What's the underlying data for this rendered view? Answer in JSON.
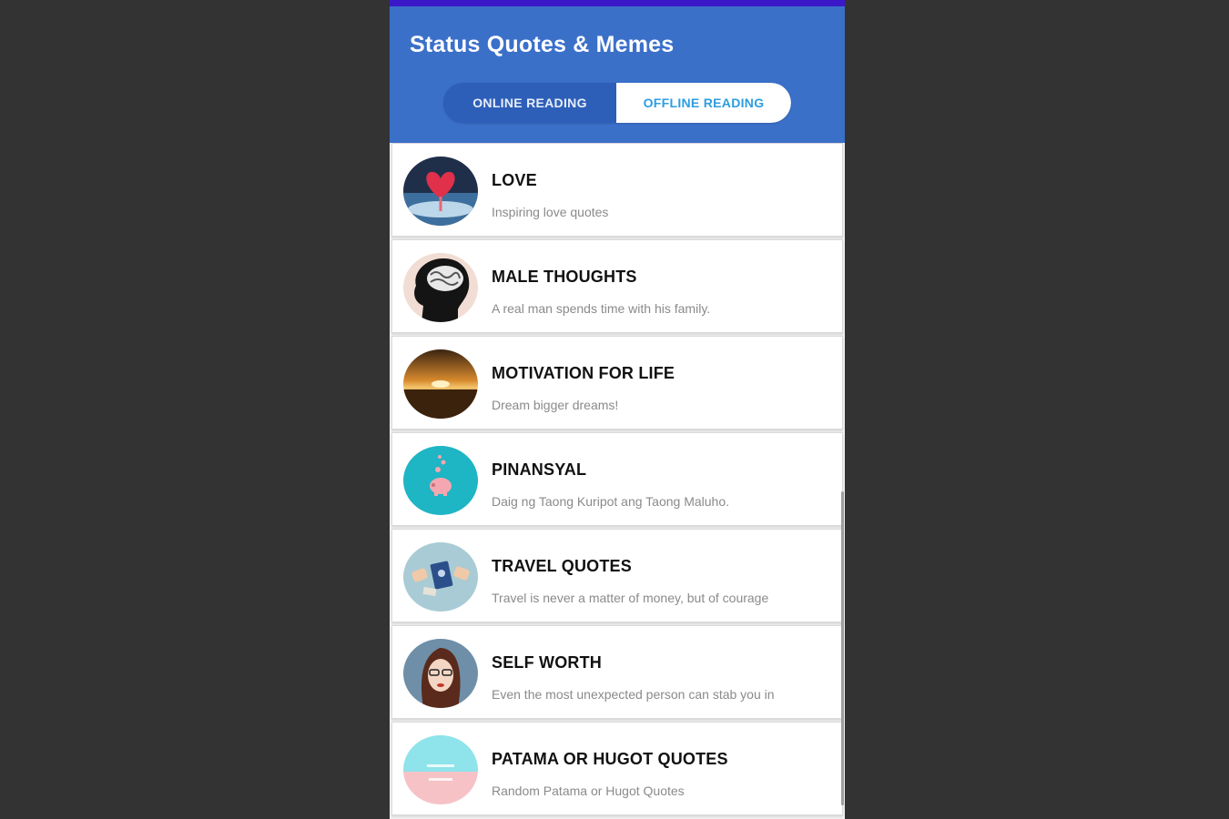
{
  "app": {
    "title": "Status Quotes & Memes"
  },
  "tabs": {
    "online_label": "ONLINE READING",
    "offline_label": "OFFLINE READING",
    "selected": "offline"
  },
  "categories": [
    {
      "title": "LOVE",
      "subtitle": "Inspiring love quotes",
      "icon": "love-heart-icon"
    },
    {
      "title": "MALE THOUGHTS",
      "subtitle": "A real man spends time with his family.",
      "icon": "head-silhouette-icon"
    },
    {
      "title": "MOTIVATION FOR LIFE",
      "subtitle": "Dream bigger dreams!",
      "icon": "sunset-icon"
    },
    {
      "title": "PINANSYAL",
      "subtitle": "Daig ng Taong Kuripot ang Taong Maluho.",
      "icon": "piggy-bank-icon"
    },
    {
      "title": "TRAVEL QUOTES",
      "subtitle": "Travel is never a matter of money, but of courage",
      "icon": "passport-icon"
    },
    {
      "title": "SELF WORTH",
      "subtitle": " Even the most unexpected person can stab you in",
      "icon": "woman-portrait-icon"
    },
    {
      "title": "PATAMA OR HUGOT QUOTES",
      "subtitle": "Random Patama or Hugot Quotes",
      "icon": "patama-hugot-icon"
    }
  ],
  "colors": {
    "app_bar": "#3b70c9",
    "status_bar": "#3a18c8",
    "tab_selected_text": "#2e9de0",
    "background": "#333333"
  }
}
